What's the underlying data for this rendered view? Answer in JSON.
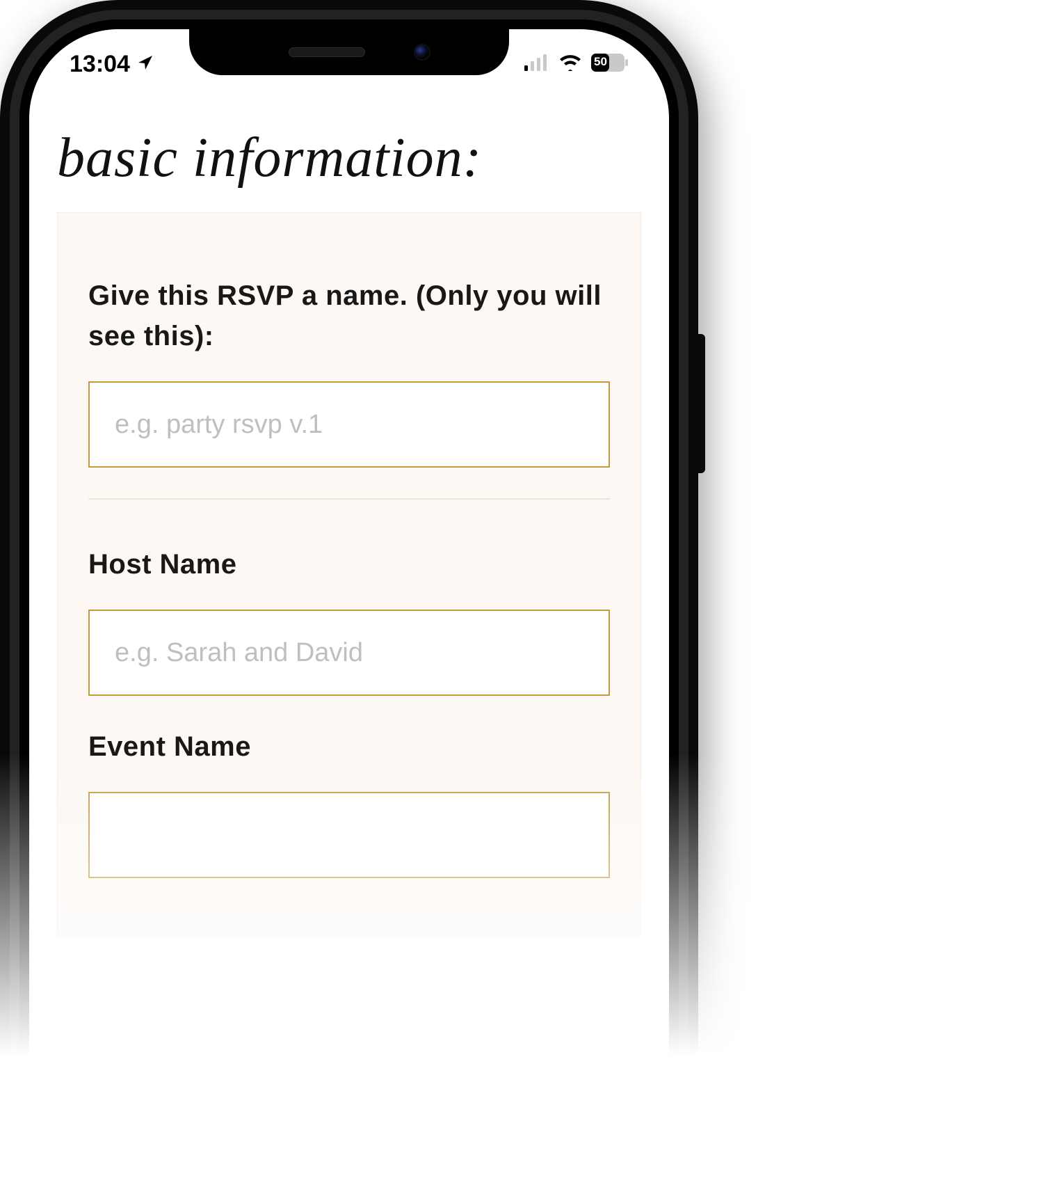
{
  "statusbar": {
    "time": "13:04",
    "battery_percent": "50"
  },
  "page": {
    "title": "basic information:"
  },
  "form": {
    "rsvp_name": {
      "label": "Give this RSVP a name. (Only you will see this):",
      "placeholder": "e.g. party rsvp v.1",
      "value": ""
    },
    "host_name": {
      "label": "Host Name",
      "placeholder": "e.g. Sarah and David",
      "value": ""
    },
    "event_name": {
      "label": "Event Name",
      "placeholder": "",
      "value": ""
    }
  }
}
